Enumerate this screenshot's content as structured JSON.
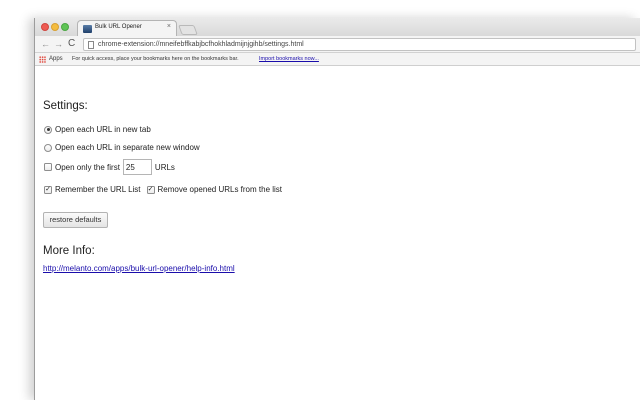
{
  "browser": {
    "tab_title": "Bulk URL Opener",
    "tab_close": "×",
    "url": "chrome-extension://mneifebffkabjbcfhokhladmijnjgihb/settings.html",
    "nav": {
      "back": "←",
      "forward": "→",
      "reload": "C"
    }
  },
  "bookmarks_bar": {
    "apps_label": "Apps",
    "hint": "For quick access, place your bookmarks here on the bookmarks bar.",
    "import_link": "Import bookmarks now..."
  },
  "settings": {
    "heading": "Settings:",
    "open_new_tab_label": "Open each URL in new tab",
    "open_new_tab_selected": true,
    "open_new_window_label": "Open each URL in separate new window",
    "open_new_window_selected": false,
    "open_first_label_prefix": "Open only the first",
    "open_first_value": "25",
    "open_first_label_suffix": "URLs",
    "open_first_checked": false,
    "remember_label": "Remember the URL List",
    "remember_checked": true,
    "remove_opened_label": "Remove opened URLs from the list",
    "remove_opened_checked": true,
    "restore_button": "restore defaults"
  },
  "more_info": {
    "heading": "More Info:",
    "link": "http://melanto.com/apps/bulk-url-opener/help-info.html"
  },
  "colors": {
    "link": "#1a0dab",
    "close_light": "#ee5b52",
    "minimize_light": "#f4bc3f",
    "maximize_light": "#5fc456"
  }
}
